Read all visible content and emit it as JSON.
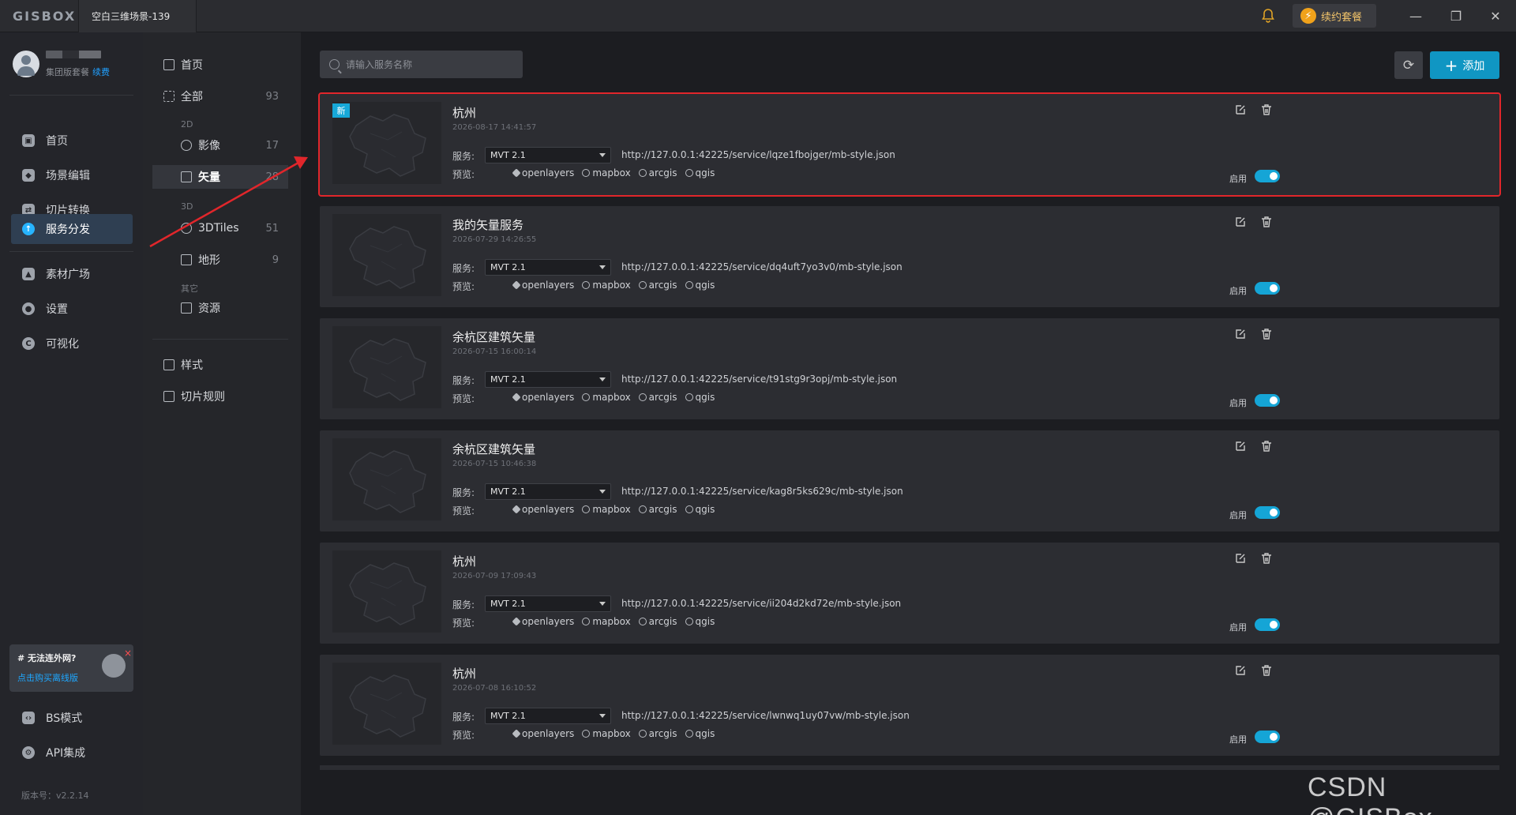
{
  "titlebar": {
    "logo": "GISBOX",
    "tab": "空白三维场景-139",
    "renew_label": "续约套餐"
  },
  "user": {
    "plan": "集团版套餐",
    "renew_link": "续费"
  },
  "nav": {
    "items": [
      {
        "label": "首页",
        "icon": "home-icon"
      },
      {
        "label": "场景编辑",
        "icon": "cube-icon"
      },
      {
        "label": "切片转换",
        "icon": "convert-icon"
      },
      {
        "label": "服务分发",
        "icon": "upload-icon"
      },
      {
        "label": "素材广场",
        "icon": "image-icon"
      },
      {
        "label": "设置",
        "icon": "gear-icon"
      },
      {
        "label": "可视化",
        "icon": "chart-icon"
      }
    ],
    "bottom": [
      {
        "label": "BS模式",
        "icon": "code-icon"
      },
      {
        "label": "API集成",
        "icon": "api-icon"
      }
    ],
    "offline": {
      "title": "# 无法连外网?",
      "link": "点击购买离线版"
    },
    "version": "版本号：v2.2.14"
  },
  "categories": {
    "home": "首页",
    "all": {
      "label": "全部",
      "count": "93"
    },
    "group_2d": "2D",
    "image": {
      "label": "影像",
      "count": "17"
    },
    "vector": {
      "label": "矢量",
      "count": "28"
    },
    "group_3d": "3D",
    "tiles3d": {
      "label": "3DTiles",
      "count": "51"
    },
    "terrain": {
      "label": "地形",
      "count": "9"
    },
    "group_other": "其它",
    "resource": "资源",
    "style": "样式",
    "tile_rule": "切片规则"
  },
  "toolbar": {
    "search_placeholder": "请输入服务名称",
    "add_label": "添加"
  },
  "card_labels": {
    "service": "服务:",
    "preview": "预览:",
    "enable": "启用",
    "new_badge": "新",
    "preview_links": [
      "openlayers",
      "mapbox",
      "arcgis",
      "qgis"
    ]
  },
  "services": [
    {
      "title": "杭州",
      "date": "2026-08-17 14:41:57",
      "type": "MVT 2.1",
      "url": "http://127.0.0.1:42225/service/lqze1fbojger/mb-style.json",
      "enabled": true,
      "is_new": true
    },
    {
      "title": "我的矢量服务",
      "date": "2026-07-29 14:26:55",
      "type": "MVT 2.1",
      "url": "http://127.0.0.1:42225/service/dq4uft7yo3v0/mb-style.json",
      "enabled": true,
      "is_new": false
    },
    {
      "title": "余杭区建筑矢量",
      "date": "2026-07-15 16:00:14",
      "type": "MVT 2.1",
      "url": "http://127.0.0.1:42225/service/t91stg9r3opj/mb-style.json",
      "enabled": true,
      "is_new": false
    },
    {
      "title": "余杭区建筑矢量",
      "date": "2026-07-15 10:46:38",
      "type": "MVT 2.1",
      "url": "http://127.0.0.1:42225/service/kag8r5ks629c/mb-style.json",
      "enabled": true,
      "is_new": false
    },
    {
      "title": "杭州",
      "date": "2026-07-09 17:09:43",
      "type": "MVT 2.1",
      "url": "http://127.0.0.1:42225/service/ii204d2kd72e/mb-style.json",
      "enabled": true,
      "is_new": false
    },
    {
      "title": "杭州",
      "date": "2026-07-08 16:10:52",
      "type": "MVT 2.1",
      "url": "http://127.0.0.1:42225/service/lwnwq1uy07vw/mb-style.json",
      "enabled": true,
      "is_new": false
    }
  ],
  "watermark": "CSDN @GISBox",
  "colors": {
    "accent": "#1096c3",
    "toggle_on": "#15a5d6",
    "highlight": "#e1262b"
  }
}
